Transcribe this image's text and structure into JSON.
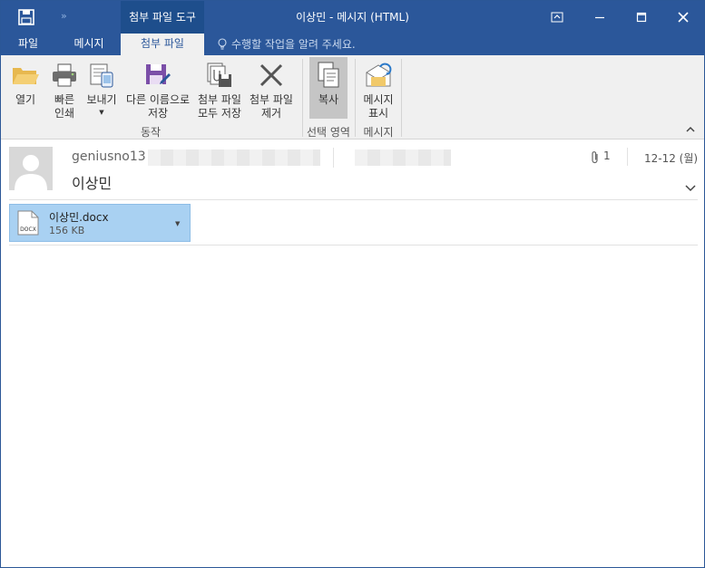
{
  "window": {
    "title": "이상민 - 메시지 (HTML)",
    "context_tab_group": "첨부 파일 도구",
    "qat_more": "»"
  },
  "tabs": {
    "file": "파일",
    "message": "메시지",
    "attachment": "첨부 파일",
    "tell_me": "수행할 작업을 알려 주세요."
  },
  "ribbon": {
    "open": "열기",
    "quick_print": "빠른\n인쇄",
    "send": "보내기",
    "save_as": "다른 이름으로\n저장",
    "save_all": "첨부 파일\n모두 저장",
    "remove": "첨부 파일\n제거",
    "copy": "복사",
    "show_message": "메시지\n표시",
    "groups": {
      "actions": "동작",
      "selection": "선택 영역",
      "message": "메시지"
    }
  },
  "header": {
    "sender": "geniusno13",
    "subject": "이상민",
    "attachment_count": "1",
    "date": "12-12 (월)"
  },
  "attachment": {
    "name": "이상민.docx",
    "size": "156 KB",
    "icon_label": "DOCX"
  },
  "colors": {
    "title_bar": "#2b579a",
    "ribbon": "#f0f0f0",
    "attachment_selected": "#a9d1f2"
  }
}
